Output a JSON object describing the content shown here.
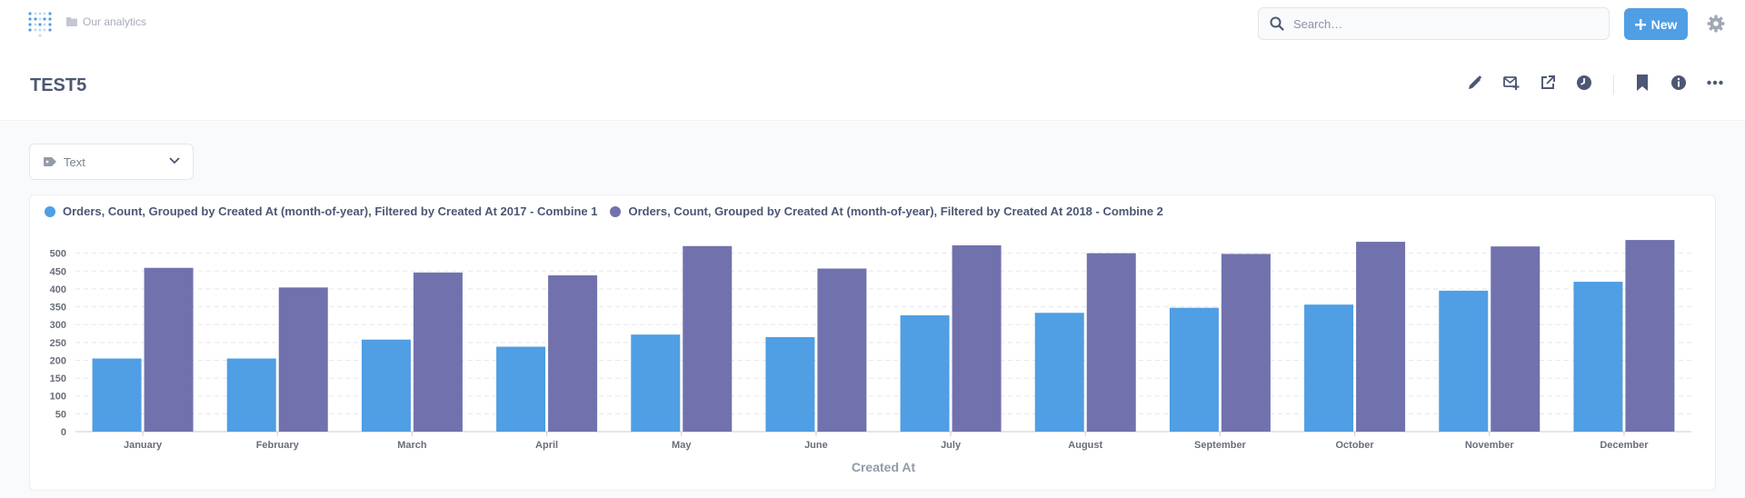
{
  "nav": {
    "breadcrumb": "Our analytics",
    "search_placeholder": "Search…",
    "new_label": "New"
  },
  "header": {
    "title": "TEST5"
  },
  "filter": {
    "label": "Text"
  },
  "colors": {
    "series1": "#509ee3",
    "series2": "#7172ad",
    "accent": "#509ee3"
  },
  "chart_data": {
    "type": "bar",
    "categories": [
      "January",
      "February",
      "March",
      "April",
      "May",
      "June",
      "July",
      "August",
      "September",
      "October",
      "November",
      "December"
    ],
    "series": [
      {
        "name": "Orders, Count, Grouped by Created At (month-of-year), Filtered by Created At 2017 - Combine 1",
        "values": [
          205,
          205,
          258,
          238,
          272,
          265,
          326,
          333,
          347,
          356,
          395,
          420
        ]
      },
      {
        "name": "Orders, Count, Grouped by Created At (month-of-year), Filtered by Created At 2018 - Combine 2",
        "values": [
          459,
          404,
          446,
          438,
          520,
          457,
          522,
          500,
          498,
          532,
          519,
          537
        ]
      }
    ],
    "xlabel": "Created At",
    "ylabel": "",
    "yticks": [
      0,
      50,
      100,
      150,
      200,
      250,
      300,
      350,
      400,
      450,
      500
    ],
    "ylim": [
      0,
      550
    ],
    "grid": true,
    "legend_position": "top-left"
  }
}
